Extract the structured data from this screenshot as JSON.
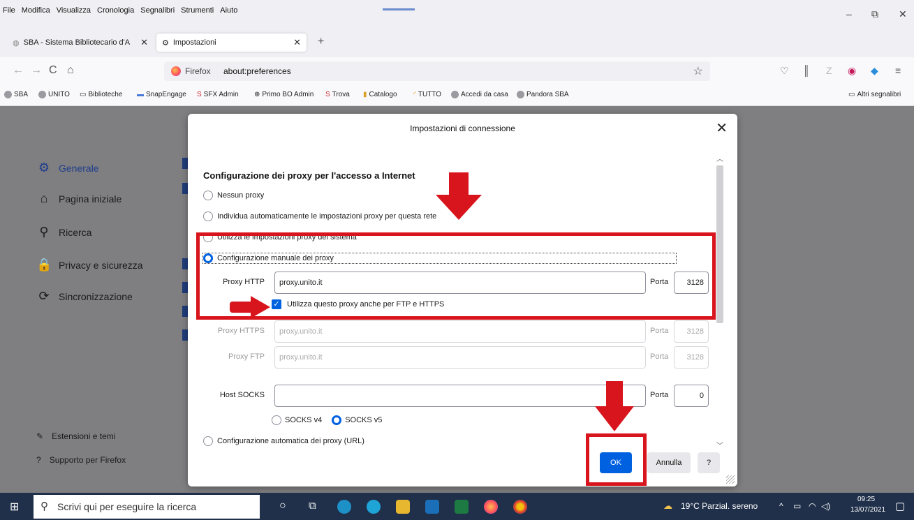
{
  "menubar": {
    "items": [
      "File",
      "Modifica",
      "Visualizza",
      "Cronologia",
      "Segnalibri",
      "Strumenti",
      "Aiuto"
    ],
    "window_controls": [
      "–",
      "⧉",
      "✕"
    ]
  },
  "tabs": [
    {
      "label": "SBA - Sistema Bibliotecario d'A",
      "close": "✕"
    },
    {
      "label": "Impostazioni",
      "close": "✕"
    }
  ],
  "new_tab": "+",
  "nav": {
    "back": "←",
    "forward": "→",
    "reload": "C",
    "home": "⌂",
    "url_brand": "Firefox",
    "url": "about:preferences",
    "star": "☆"
  },
  "bookmarks": [
    {
      "label": "SBA",
      "color": "#9a9aa0"
    },
    {
      "label": "UNITO",
      "color": "#9a9aa0"
    },
    {
      "label": "Biblioteche",
      "color": "#ffffff"
    },
    {
      "label": "SnapEngage",
      "color": "#4a7ad8"
    },
    {
      "label": "SFX Admin",
      "color": "#c8262c"
    },
    {
      "label": "Primo BO Admin",
      "color": "#ffffff"
    },
    {
      "label": "Trova",
      "color": "#c8262c"
    },
    {
      "label": "Catalogo",
      "color": "#d9a32a"
    },
    {
      "label": "TUTTO",
      "color": "#f0a020"
    },
    {
      "label": "Accedi da casa",
      "color": "#9a9aa0"
    },
    {
      "label": "Pandora SBA",
      "color": "#9a9aa0"
    }
  ],
  "other_bookmarks": "Altri segnalibri",
  "sidebar": {
    "items": [
      {
        "label": "Generale",
        "icon": "⚙"
      },
      {
        "label": "Pagina iniziale",
        "icon": "⌂"
      },
      {
        "label": "Ricerca",
        "icon": "⚲"
      },
      {
        "label": "Privacy e sicurezza",
        "icon": "🔒"
      },
      {
        "label": "Sincronizzazione",
        "icon": "⟳"
      }
    ],
    "footer": [
      {
        "label": "Estensioni e temi",
        "icon": "✎"
      },
      {
        "label": "Supporto per Firefox",
        "icon": "?"
      }
    ]
  },
  "dialog": {
    "title": "Impostazioni di connessione",
    "close": "✕",
    "heading": "Configurazione dei proxy per l'accesso a Internet",
    "options": {
      "none": "Nessun proxy",
      "auto_detect": "Individua automaticamente le impostazioni proxy per questa rete",
      "system": "Utilizza le impostazioni proxy del sistema",
      "manual": "Configurazione manuale dei proxy",
      "pac": "Configurazione automatica dei proxy (URL)"
    },
    "selected_option": "manual",
    "http": {
      "label": "Proxy HTTP",
      "value": "proxy.unito.it",
      "port_label": "Porta",
      "port": "3128"
    },
    "use_for_all": "Utilizza questo proxy anche per FTP e HTTPS",
    "https": {
      "label": "Proxy HTTPS",
      "value": "proxy.unito.it",
      "port_label": "Porta",
      "port": "3128"
    },
    "ftp": {
      "label": "Proxy FTP",
      "value": "proxy.unito.it",
      "port_label": "Porta",
      "port": "3128"
    },
    "socks": {
      "label": "Host SOCKS",
      "value": "",
      "port_label": "Porta",
      "port": "0"
    },
    "socks_versions": [
      "SOCKS v4",
      "SOCKS v5"
    ],
    "socks_selected": "SOCKS v5",
    "buttons": {
      "ok": "OK",
      "cancel": "Annulla",
      "help": "?"
    }
  },
  "annotation_color": "#d8141d",
  "taskbar": {
    "search_placeholder": "Scrivi qui per eseguire la ricerca",
    "weather": "19°C Parzial. sereno",
    "time": "09:25",
    "date": "13/07/2021"
  }
}
